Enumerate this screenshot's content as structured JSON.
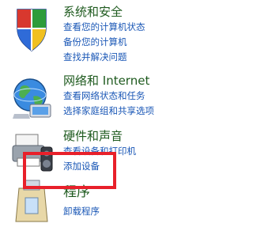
{
  "categories": [
    {
      "icon": "security-shield-icon",
      "title": "系统和安全",
      "links": [
        "查看您的计算机状态",
        "备份您的计算机",
        "查找并解决问题"
      ]
    },
    {
      "icon": "network-globe-icon",
      "title": "网络和 Internet",
      "links": [
        "查看网络状态和任务",
        "选择家庭组和共享选项"
      ]
    },
    {
      "icon": "printer-speaker-icon",
      "title": "硬件和声音",
      "links": [
        "查看设备和打印机",
        "添加设备"
      ]
    },
    {
      "icon": "programs-box-icon",
      "title": "程序",
      "links": [
        "卸载程序"
      ]
    }
  ],
  "colors": {
    "title": "#1e5a1e",
    "link": "#1a57b6",
    "highlight": "#e8202a"
  }
}
